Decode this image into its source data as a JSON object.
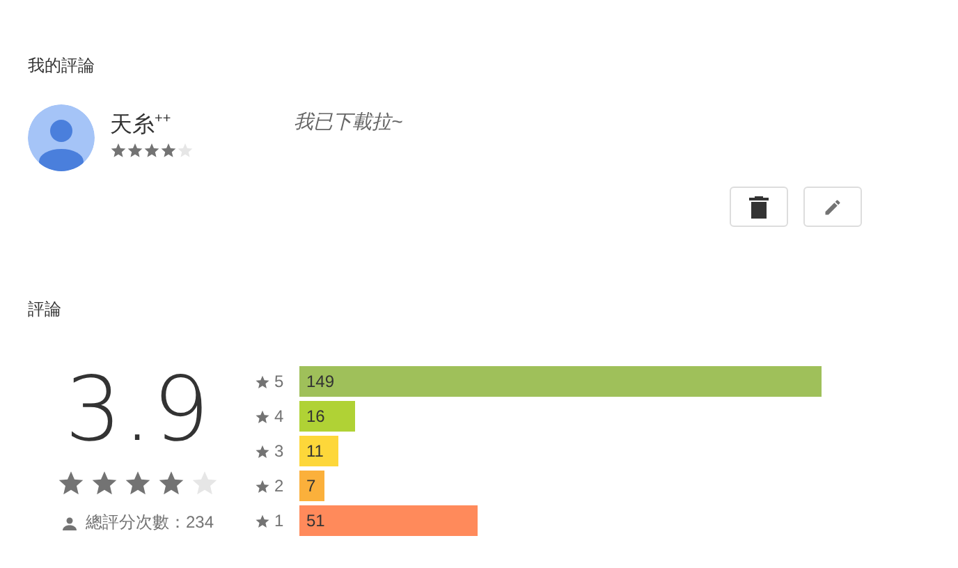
{
  "my_review": {
    "title": "我的評論",
    "author": "天糸$^{++}$",
    "stars": 4,
    "text": "我已下載拉~",
    "buttons": [
      {
        "kind": "delete"
      },
      {
        "kind": "edit"
      }
    ]
  },
  "reviews": {
    "title": "評論",
    "score": "3.9",
    "stars": 4,
    "total": "總評分次數：234",
    "bars": [
      {
        "label": "5",
        "count": "149",
        "color": "#9fc05a"
      },
      {
        "label": "4",
        "count": "16",
        "color": "#b0d235"
      },
      {
        "label": "3",
        "count": "11",
        "color": "#fdd73a"
      },
      {
        "label": "2",
        "count": "7",
        "color": "#fbb03b"
      },
      {
        "label": "1",
        "count": "51",
        "color": "#ff8a5b"
      }
    ]
  }
}
